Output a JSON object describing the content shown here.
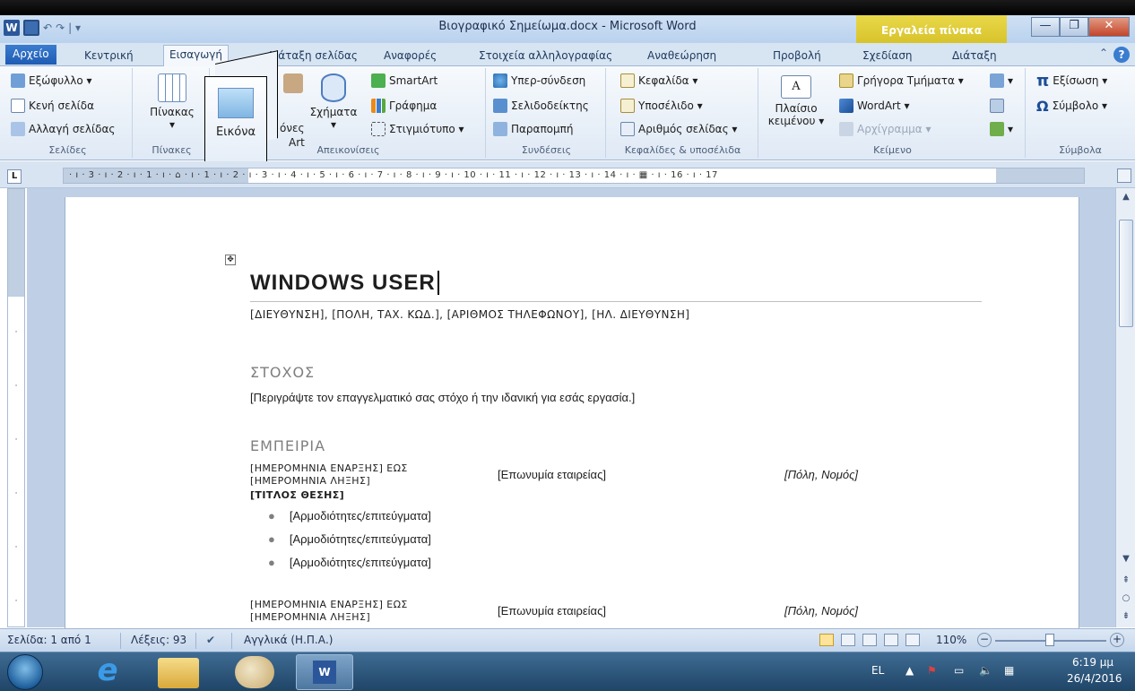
{
  "window": {
    "title": "Βιογραφικό Σημείωμα.docx - Microsoft Word",
    "context_tab": "Εργαλεία πίνακα",
    "qat_sep": "| ▾"
  },
  "tabs": {
    "file": "Αρχείο",
    "home": "Κεντρική",
    "insert": "Εισαγωγή",
    "layout": "Διάταξη σελίδας",
    "references": "Αναφορές",
    "mailings": "Στοιχεία αλληλογραφίας",
    "review": "Αναθεώρηση",
    "view": "Προβολή",
    "design": "Σχεδίαση",
    "table_layout": "Διάταξη"
  },
  "ribbon": {
    "pages": {
      "cover": "Εξώφυλλο ▾",
      "blank": "Κενή σελίδα",
      "break": "Αλλαγή σελίδας",
      "label": "Σελίδες"
    },
    "tables": {
      "table": "Πίνακας",
      "table_arrow": "▾",
      "label": "Πίνακες"
    },
    "illustrations": {
      "picture_letter": "Ε",
      "picture_tooltip": "Εικόνα",
      "clipart_partial": "όνες",
      "clipart_line2": "Art",
      "shapes": "Σχήματα",
      "shapes_arrow": "▾",
      "smartart": "SmartArt",
      "chart": "Γράφημα",
      "screenshot": "Στιγμιότυπο ▾",
      "label": "Απεικονίσεις"
    },
    "links": {
      "hyperlink": "Υπερ-σύνδεση",
      "bookmark": "Σελιδοδείκτης",
      "crossref": "Παραπομπή",
      "label": "Συνδέσεις"
    },
    "header_footer": {
      "header": "Κεφαλίδα ▾",
      "footer": "Υποσέλιδο ▾",
      "page_number": "Αριθμός σελίδας ▾",
      "label": "Κεφαλίδες & υποσέλιδα"
    },
    "text": {
      "textbox_line1": "Πλαίσιο",
      "textbox_line2": "κειμένου ▾",
      "quick_parts": "Γρήγορα Τμήματα ▾",
      "wordart": "WordArt ▾",
      "dropcap": "Αρχίγραμμα ▾",
      "label": "Κείμενο"
    },
    "symbols": {
      "equation": "Εξίσωση ▾",
      "symbol": "Σύμβολο ▾",
      "label": "Σύμβολα",
      "pi": "π",
      "omega": "Ω"
    }
  },
  "ruler": {
    "corner": "L",
    "ticks": "· ı · 3 · ı · 2 · ı · 1 · ı · ⌂ · ı · 1 · ı · 2 · ı · 3 · ı · 4 · ı · 5 · ı · 6 · ı · 7 · ı · 8 · ı · 9 · ı · 10 · ı · 11 · ı · 12 · ı · 13 · ı · 14 · ı · ▦ · ı · 16 · ı · 17"
  },
  "document": {
    "name": "WINDOWS USER",
    "contact": "[ΔΙΕΥΘΥΝΣΗ], [ΠΟΛΗ, ΤΑΧ. ΚΩΔ.], [ΑΡΙΘΜΟΣ ΤΗΛΕΦΩΝΟΥ], [ΗΛ. ΔΙΕΥΘΥΝΣΗ]",
    "objective_heading": "ΣΤΟΧΟΣ",
    "objective_text": "[Περιγράψτε τον επαγγελματικό σας στόχο ή την ιδανική για εσάς εργασία.]",
    "experience_heading": "ΕΜΠΕΙΡΙΑ",
    "jobs": [
      {
        "dates_line1": "[ΗΜΕΡΟΜΗΝΙΑ ΕΝΑΡΞΗΣ] ΕΩΣ",
        "dates_line2": "[ΗΜΕΡΟΜΗΝΙΑ ΛΗΞΗΣ]",
        "company": "[Επωνυμία εταιρείας]",
        "location": "[Πόλη, Νομός]",
        "title": "[ΤΙΤΛΟΣ ΘΕΣΗΣ]",
        "bullets": [
          "[Αρμοδιότητες/επιτεύγματα]",
          "[Αρμοδιότητες/επιτεύγματα]",
          "[Αρμοδιότητες/επιτεύγματα]"
        ]
      },
      {
        "dates_line1": "[ΗΜΕΡΟΜΗΝΙΑ ΕΝΑΡΞΗΣ] ΕΩΣ",
        "dates_line2": "[ΗΜΕΡΟΜΗΝΙΑ ΛΗΞΗΣ]",
        "company": "[Επωνυμία εταιρείας]",
        "location": "[Πόλη, Νομός]"
      }
    ]
  },
  "statusbar": {
    "page": "Σελίδα: 1 από 1",
    "words": "Λέξεις: 93",
    "language": "Αγγλικά (Η.Π.Α.)",
    "zoom": "110%"
  },
  "taskbar": {
    "lang": "EL",
    "time": "6:19 μμ",
    "date": "26/4/2016"
  },
  "colors": {
    "accent": "#2b579a",
    "context_tab": "#d7c32a",
    "heading": "#7f7f7f"
  }
}
